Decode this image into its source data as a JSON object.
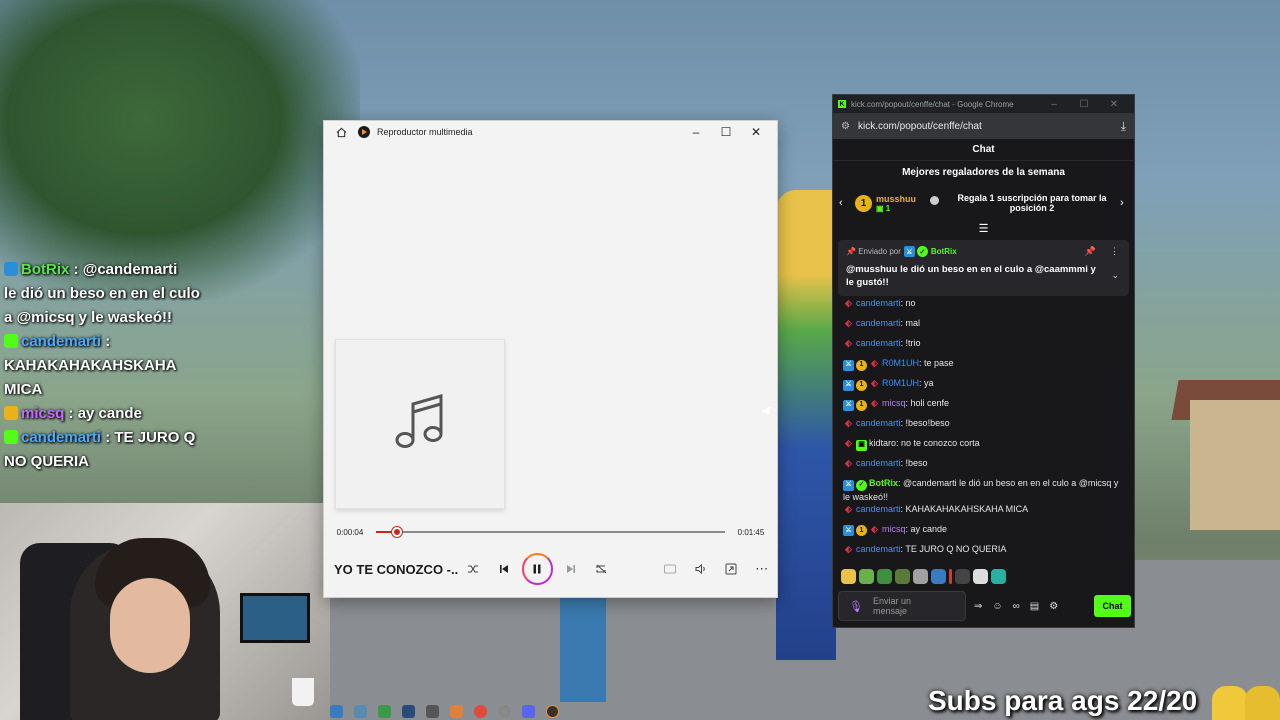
{
  "overlay_chat": [
    {
      "name": "BotRix",
      "sep": " : ",
      "text": "@candemarti"
    },
    {
      "name": "",
      "sep": "",
      "text": "le dió un beso en en el culo"
    },
    {
      "name": "",
      "sep": "",
      "text": "a @micsq y le waskeó!!"
    },
    {
      "name": "candemarti",
      "sep": " :",
      "text": ""
    },
    {
      "name": "",
      "sep": "",
      "text": "KAHAKAHAKAHSKAHA"
    },
    {
      "name": "",
      "sep": "",
      "text": "MICA"
    },
    {
      "name": "micsq",
      "sep": " : ",
      "text": "ay cande"
    },
    {
      "name": "candemarti",
      "sep": " : ",
      "text": "TE JURO Q"
    },
    {
      "name": "",
      "sep": "",
      "text": "NO QUERIA"
    }
  ],
  "player": {
    "title": "Reproductor multimedia",
    "elapsed": "0:00:04",
    "total": "0:01:45",
    "progress": 0.06,
    "song_title": "YO TE CONOZCO -..."
  },
  "chrome": {
    "window_title": "kick.com/popout/cenffe/chat - Google Chrome",
    "url": "kick.com/popout/cenffe/chat"
  },
  "chat": {
    "header": "Chat",
    "gifters_title": "Mejores regaladores de la semana",
    "top_gifter": {
      "rank": "1",
      "name": "musshuu",
      "count": "1"
    },
    "gift_cta": "Regala 1 suscripción para tomar la posición 2",
    "pinned": {
      "sent_by": "Enviado por",
      "author": "BotRix",
      "text": "@musshuu le dió un beso en en el culo a @caammmi y le gustó!!"
    },
    "messages": [
      {
        "user": "candemarti",
        "cls": "u-cande",
        "badges": [
          "pepper"
        ],
        "text": "no"
      },
      {
        "user": "candemarti",
        "cls": "u-cande",
        "badges": [
          "pepper"
        ],
        "text": "mal"
      },
      {
        "user": "candemarti",
        "cls": "u-cande",
        "badges": [
          "pepper"
        ],
        "text": "!trio"
      },
      {
        "user": "R0M1UH",
        "cls": "u-rom",
        "badges": [
          "mod",
          "sub",
          "pepper"
        ],
        "text": "te pase"
      },
      {
        "user": "R0M1UH",
        "cls": "u-rom",
        "badges": [
          "mod",
          "sub",
          "pepper"
        ],
        "text": "ya"
      },
      {
        "user": "micsq",
        "cls": "u-micsq",
        "badges": [
          "mod",
          "sub",
          "pepper"
        ],
        "text": "holi cenfe"
      },
      {
        "user": "candemarti",
        "cls": "u-cande",
        "badges": [
          "pepper"
        ],
        "text": "!beso!beso"
      },
      {
        "user": "kidtaro",
        "cls": "u-kid",
        "badges": [
          "pepper",
          "gift"
        ],
        "text": "no te conozco corta"
      },
      {
        "user": "candemarti",
        "cls": "u-cande",
        "badges": [
          "pepper"
        ],
        "text": "!beso"
      },
      {
        "user": "BotRix",
        "cls": "u-botrix",
        "badges": [
          "mod",
          "verif"
        ],
        "text": "@candemarti le dió un beso en en el culo a @micsq y le waskeó!!"
      },
      {
        "user": "candemarti",
        "cls": "u-cande",
        "badges": [
          "pepper"
        ],
        "text": "KAHAKAHAKAHSKAHA MICA"
      },
      {
        "user": "micsq",
        "cls": "u-micsq",
        "badges": [
          "mod",
          "sub",
          "pepper"
        ],
        "text": "ay cande"
      },
      {
        "user": "candemarti",
        "cls": "u-cande",
        "badges": [
          "pepper"
        ],
        "text": "TE JURO Q NO QUERIA"
      }
    ],
    "input_placeholder": "Enviar un mensaje",
    "send_label": "Chat"
  },
  "stream_overlay": {
    "subs_text": "Subs para ags 22/20"
  }
}
